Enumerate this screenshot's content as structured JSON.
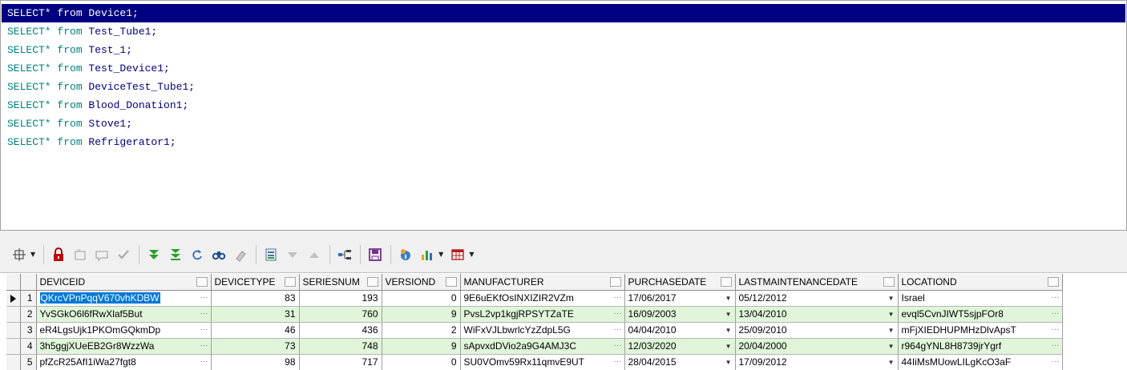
{
  "editor": {
    "lines": [
      {
        "kw": "SELECT* from ",
        "id": "Device1;",
        "selected": true
      },
      {
        "kw": "SELECT* from ",
        "id": "Test_Tube1;"
      },
      {
        "kw": "SELECT* from ",
        "id": "Test_1;"
      },
      {
        "kw": "SELECT* from ",
        "id": "Test_Device1;"
      },
      {
        "kw": "SELECT* from ",
        "id": "DeviceTest_Tube1;"
      },
      {
        "kw": "SELECT* from ",
        "id": "Blood_Donation1;"
      },
      {
        "kw": "SELECT* from ",
        "id": "Stove1;"
      },
      {
        "kw": "SELECT* from ",
        "id": "Refrigerator1;"
      }
    ]
  },
  "toolbar": {
    "icons": [
      "grid-options-icon",
      "lock-icon",
      "insert-record-icon",
      "edit-record-icon",
      "post-icon",
      "fetch-next-icon",
      "fetch-all-icon",
      "refresh-icon",
      "find-icon",
      "clear-icon",
      "export-icon",
      "filter-down-icon",
      "filter-up-icon",
      "tree-view-icon",
      "save-icon",
      "query-info-icon",
      "chart-icon",
      "table-view-icon"
    ]
  },
  "grid": {
    "columns": [
      "DEVICEID",
      "DEVICETYPE",
      "SERIESNUM",
      "VERSIOND",
      "MANUFACTURER",
      "PURCHASEDATE",
      "LASTMAINTENANCEDATE",
      "LOCATIOND"
    ],
    "rows": [
      {
        "n": "1",
        "cells": [
          "QKrcVPnPqqV670vhKDBW",
          "83",
          "193",
          "0",
          "9E6uEKfOsINXIZIR2VZm",
          "17/06/2017",
          "05/12/2012",
          "Israel"
        ]
      },
      {
        "n": "2",
        "cells": [
          "YvSGkO6l6fRwXlaf5But",
          "31",
          "760",
          "9",
          "PvsL2vp1kgjRPSYTZaTE",
          "16/09/2003",
          "13/04/2010",
          "evql5CvnJIWT5sjpFOr8"
        ]
      },
      {
        "n": "3",
        "cells": [
          "eR4LgsUjk1PKOmGQkmDp",
          "46",
          "436",
          "2",
          "WiFxVJLbwrlcYzZdpL5G",
          "04/04/2010",
          "25/09/2010",
          "mFjXIEDHUPMHzDlvApsT"
        ]
      },
      {
        "n": "4",
        "cells": [
          "3h5ggjXUeEB2Gr8WzzWa",
          "73",
          "748",
          "9",
          "sApvxdDVio2a9G4AMJ3C",
          "12/03/2020",
          "20/04/2000",
          "r964gYNL8H8739jrYgrf"
        ]
      },
      {
        "n": "5",
        "cells": [
          "pfZcR25AfI1iWa27fgt8",
          "98",
          "717",
          "0",
          "SU0VOmv59Rx11qmvE9UT",
          "28/04/2015",
          "17/09/2012",
          "44IiMsMUowLILgKcO3aF"
        ]
      }
    ]
  }
}
